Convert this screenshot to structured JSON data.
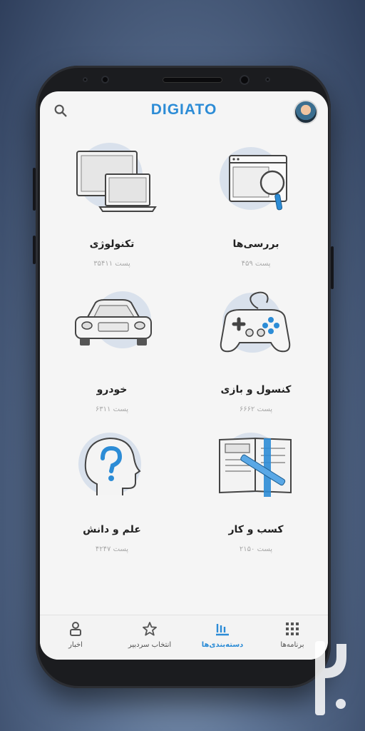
{
  "app": {
    "logo": "DIGIATO",
    "accent_color": "#2c8cd6"
  },
  "header": {
    "search_icon": "search-icon",
    "avatar_icon": "user-avatar"
  },
  "categories": [
    {
      "title": "بررسی‌ها",
      "count": "۴۵۹ پست",
      "icon": "browser-magnifier-icon"
    },
    {
      "title": "تکنولوژی",
      "count": "۳۵۴۱۱ پست",
      "icon": "devices-icon"
    },
    {
      "title": "کنسول و بازی",
      "count": "۶۶۶۲ پست",
      "icon": "gamepad-icon"
    },
    {
      "title": "خودرو",
      "count": "۶۳۱۱ پست",
      "icon": "car-icon"
    },
    {
      "title": "کسب و کار",
      "count": "۲۱۵۰ پست",
      "icon": "notebook-pen-icon"
    },
    {
      "title": "علم و دانش",
      "count": "۴۲۴۷ پست",
      "icon": "head-question-icon"
    }
  ],
  "bottom_nav": [
    {
      "label": "برنامه‌ها",
      "icon": "apps-grid-icon",
      "active": false
    },
    {
      "label": "دسته‌بندی‌ها",
      "icon": "categories-icon",
      "active": true
    },
    {
      "label": "انتخاب سردبیر",
      "icon": "star-icon",
      "active": false
    },
    {
      "label": "اخبار",
      "icon": "news-user-icon",
      "active": false
    }
  ]
}
